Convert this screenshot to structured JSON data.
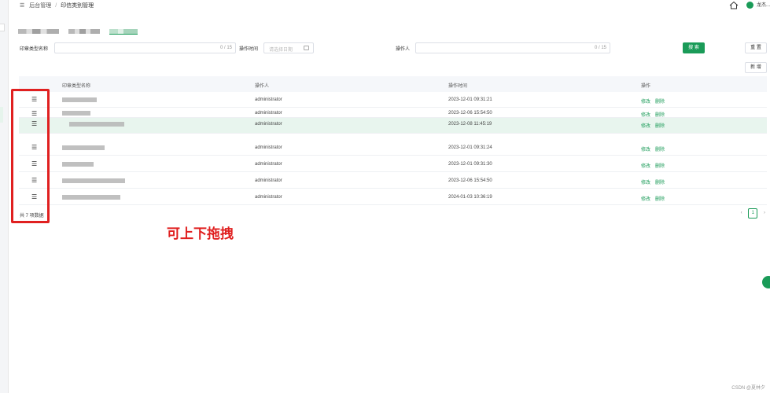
{
  "breadcrumb": {
    "root": "后台管理",
    "separator": "/",
    "current": "印信类别管理"
  },
  "user": {
    "name": "龙杰..."
  },
  "tabs": [
    "",
    "",
    ""
  ],
  "search": {
    "name_label": "印章类型名称",
    "name_count": "0 / 15",
    "time_label": "操作时间",
    "time_placeholder": "请选择日期",
    "operator_label": "操作人",
    "operator_count": "0 / 15",
    "search_button": "搜 索",
    "reset_button": "重 置",
    "add_button": "新 增"
  },
  "table": {
    "headers": {
      "name": "印章类型名称",
      "operator": "操作人",
      "time": "操作时间",
      "actions": "操作"
    },
    "rows": [
      {
        "operator": "administrator",
        "time": "2023-12-01 09:31:21"
      },
      {
        "operator": "administrator",
        "time": "2023-12-06 15:54:50"
      },
      {
        "operator": "administrator",
        "time": "2023-12-08 11:45:19"
      },
      {
        "operator": "administrator",
        "time": "2023-12-01 09:31:24"
      },
      {
        "operator": "administrator",
        "time": "2023-12-01 09:31:30"
      },
      {
        "operator": "administrator",
        "time": "2023-12-06 15:54:50"
      },
      {
        "operator": "administrator",
        "time": "2024-01-03 10:36:19"
      }
    ],
    "edit_label": "修改",
    "delete_label": "删除",
    "drag_glyph": "☰"
  },
  "footer": {
    "total": "共 7 项数据",
    "page": "1",
    "prev": "‹",
    "next": "›"
  },
  "annotation": {
    "text": "可上下拖拽"
  },
  "watermark": "CSDN @夏林夕",
  "colors": {
    "accent": "#1a9b58",
    "annotation": "#e02020",
    "highlight_row": "#e8f5ee"
  }
}
